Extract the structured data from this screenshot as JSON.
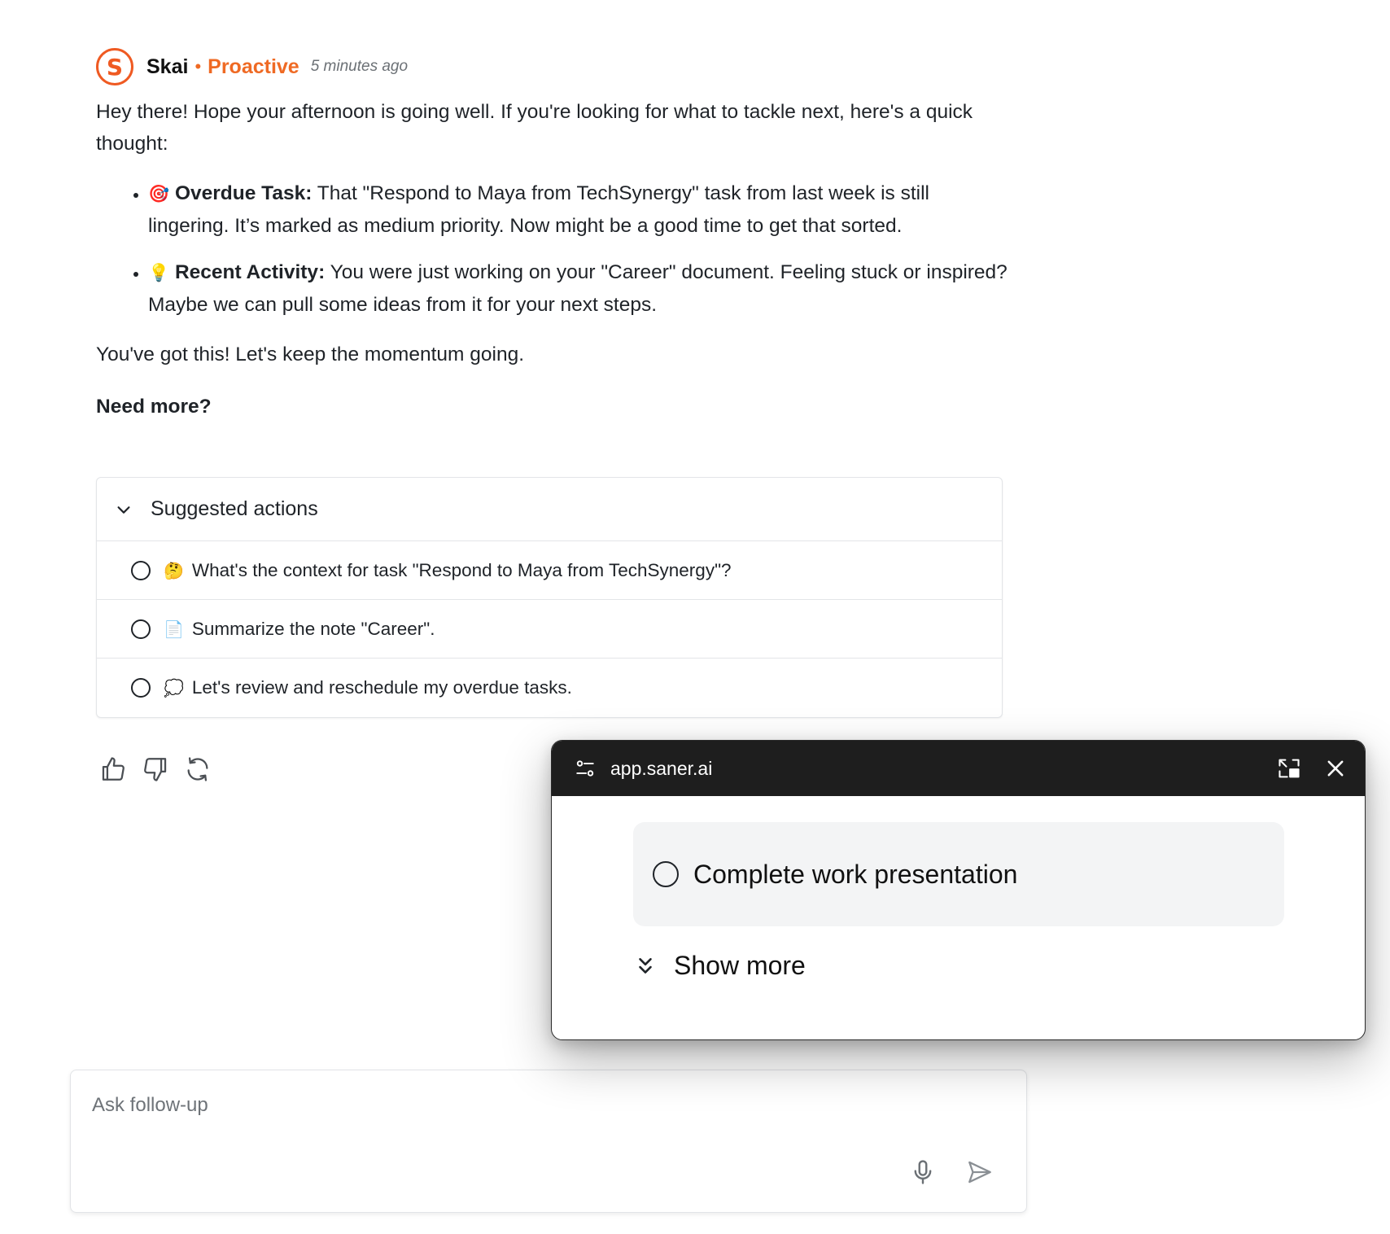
{
  "message": {
    "avatar_letter": "S",
    "sender": "Skai",
    "separator": "•",
    "mode": "Proactive",
    "timestamp": "5 minutes ago",
    "intro": "Hey there! Hope your afternoon is going well. If you're looking for what to tackle next, here's a quick thought:",
    "bullets": [
      {
        "emoji": "🎯",
        "label": "Overdue Task:",
        "text": " That \"Respond to Maya from TechSynergy\" task from last week is still lingering. It’s marked as medium priority. Now might be a good time to get that sorted."
      },
      {
        "emoji": "💡",
        "label": "Recent Activity:",
        "text": " You were just working on your \"Career\" document. Feeling stuck or inspired? Maybe we can pull some ideas from it for your next steps."
      }
    ],
    "closing": "You've got this! Let's keep the momentum going.",
    "need_more": "Need more?"
  },
  "suggested_actions": {
    "title": "Suggested actions",
    "items": [
      {
        "emoji": "🤔",
        "text": "What's the context for task \"Respond to Maya from TechSynergy\"?"
      },
      {
        "emoji": "📄",
        "text": "Summarize the note \"Career\"."
      },
      {
        "emoji": "💭",
        "text": "Let's review and reschedule my overdue tasks."
      }
    ]
  },
  "feedback": {
    "icons": [
      "thumbs-up-icon",
      "thumbs-down-icon",
      "regenerate-icon"
    ]
  },
  "input": {
    "placeholder": "Ask follow-up",
    "value": ""
  },
  "popup": {
    "url": "app.saner.ai",
    "task_title": "Complete work presentation",
    "show_more": "Show more"
  },
  "colors": {
    "brand_orange": "#ef6a24",
    "popup_bar": "#1e1e1e",
    "task_card_bg": "#f3f4f5"
  }
}
